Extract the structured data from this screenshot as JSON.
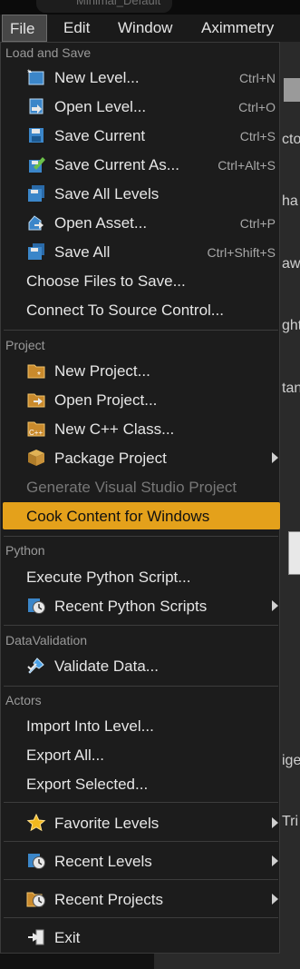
{
  "window": {
    "title": "Minimal_Default"
  },
  "menubar": {
    "items": [
      "File",
      "Edit",
      "Window",
      "Aximmetry"
    ]
  },
  "background_fragments": [
    "cto",
    "ha",
    "aw",
    "ght",
    "tan",
    "ige",
    "Tri"
  ],
  "file_menu": {
    "sections": [
      {
        "header": "Load and Save",
        "items": [
          {
            "label": "New Level...",
            "shortcut": "Ctrl+N",
            "icon": "new-level-icon"
          },
          {
            "label": "Open Level...",
            "shortcut": "Ctrl+O",
            "icon": "open-level-icon"
          },
          {
            "label": "Save Current",
            "shortcut": "Ctrl+S",
            "icon": "save-icon"
          },
          {
            "label": "Save Current As...",
            "shortcut": "Ctrl+Alt+S",
            "icon": "save-as-icon"
          },
          {
            "label": "Save All Levels",
            "shortcut": "",
            "icon": "save-all-levels-icon"
          },
          {
            "label": "Open Asset...",
            "shortcut": "Ctrl+P",
            "icon": "open-asset-icon"
          },
          {
            "label": "Save All",
            "shortcut": "Ctrl+Shift+S",
            "icon": "save-all-icon"
          },
          {
            "label": "Choose Files to Save...",
            "shortcut": "",
            "icon": ""
          },
          {
            "label": "Connect To Source Control...",
            "shortcut": "",
            "icon": ""
          }
        ]
      },
      {
        "header": "Project",
        "items": [
          {
            "label": "New Project...",
            "icon": "new-project-icon"
          },
          {
            "label": "Open Project...",
            "icon": "open-project-icon"
          },
          {
            "label": "New C++ Class...",
            "icon": "cpp-class-icon"
          },
          {
            "label": "Package Project",
            "icon": "package-icon",
            "submenu": true
          },
          {
            "label": "Generate Visual Studio Project",
            "icon": "",
            "disabled": true
          },
          {
            "label": "Cook Content for Windows",
            "icon": "",
            "highlighted": true
          }
        ]
      },
      {
        "header": "Python",
        "items": [
          {
            "label": "Execute Python Script...",
            "icon": ""
          },
          {
            "label": "Recent Python Scripts",
            "icon": "recent-clock-icon",
            "submenu": true
          }
        ]
      },
      {
        "header": "DataValidation",
        "items": [
          {
            "label": "Validate Data...",
            "icon": "validate-icon"
          }
        ]
      },
      {
        "header": "Actors",
        "items": [
          {
            "label": "Import Into Level...",
            "icon": ""
          },
          {
            "label": "Export All...",
            "icon": ""
          },
          {
            "label": "Export Selected...",
            "icon": ""
          }
        ]
      },
      {
        "header": "",
        "items": [
          {
            "label": "Favorite Levels",
            "icon": "star-icon",
            "submenu": true
          }
        ]
      },
      {
        "header": "",
        "items": [
          {
            "label": "Recent Levels",
            "icon": "recent-clock-icon",
            "submenu": true
          }
        ]
      },
      {
        "header": "",
        "items": [
          {
            "label": "Recent Projects",
            "icon": "recent-projects-icon",
            "submenu": true
          }
        ]
      },
      {
        "header": "",
        "items": [
          {
            "label": "Exit",
            "icon": "exit-icon"
          }
        ]
      }
    ]
  }
}
